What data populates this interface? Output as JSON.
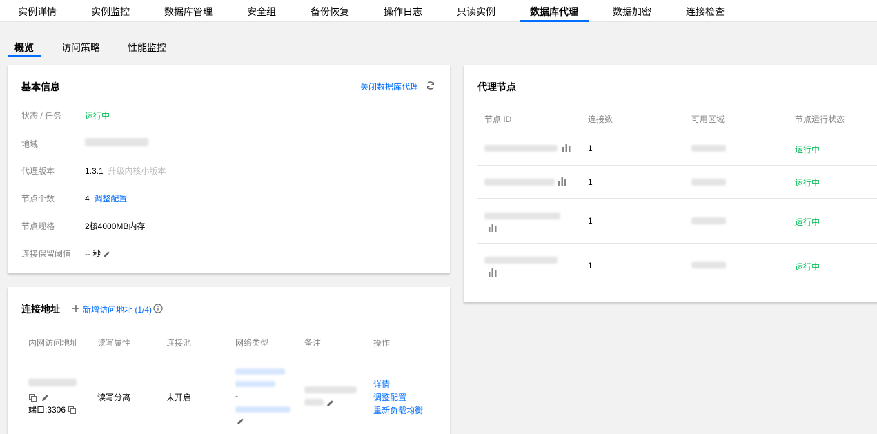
{
  "top_tabs": [
    {
      "label": "实例详情"
    },
    {
      "label": "实例监控"
    },
    {
      "label": "数据库管理"
    },
    {
      "label": "安全组"
    },
    {
      "label": "备份恢复"
    },
    {
      "label": "操作日志"
    },
    {
      "label": "只读实例"
    },
    {
      "label": "数据库代理",
      "active": true
    },
    {
      "label": "数据加密"
    },
    {
      "label": "连接检查"
    }
  ],
  "sub_tabs": [
    {
      "label": "概览",
      "active": true
    },
    {
      "label": "访问策略"
    },
    {
      "label": "性能监控"
    }
  ],
  "basic_info": {
    "title": "基本信息",
    "close_proxy_link": "关闭数据库代理",
    "refresh_icon": "refresh-icon",
    "status_label": "状态 / 任务",
    "status_value": "运行中",
    "region_label": "地域",
    "version_label": "代理版本",
    "version_value": "1.3.1",
    "version_upgrade": "升级内核小版本",
    "node_count_label": "节点个数",
    "node_count_value": "4",
    "adjust_config_link": "调整配置",
    "node_spec_label": "节点规格",
    "node_spec_value": "2核4000MB内存",
    "keepalive_label": "连接保留阈值",
    "keepalive_value": "-- 秒"
  },
  "proxy_nodes": {
    "title": "代理节点",
    "headers": [
      "节点 ID",
      "连接数",
      "可用区域",
      "节点运行状态"
    ],
    "rows": [
      {
        "connections": "1",
        "status": "运行中"
      },
      {
        "connections": "1",
        "status": "运行中"
      },
      {
        "connections": "1",
        "status": "运行中"
      },
      {
        "connections": "1",
        "status": "运行中"
      }
    ]
  },
  "connection": {
    "title": "连接地址",
    "add_link": "新增访问地址 (1/4)",
    "headers": [
      "内网访问地址",
      "读写属性",
      "连接池",
      "网络类型",
      "备注",
      "操作"
    ],
    "row": {
      "port": "端口:3306",
      "rw": "读写分离",
      "pool": "未开启",
      "net_sep": "-",
      "actions": [
        "详情",
        "调整配置",
        "重新负载均衡"
      ]
    }
  },
  "colors": {
    "accent": "#006eff",
    "success": "#0abf5b",
    "muted": "#888888"
  }
}
